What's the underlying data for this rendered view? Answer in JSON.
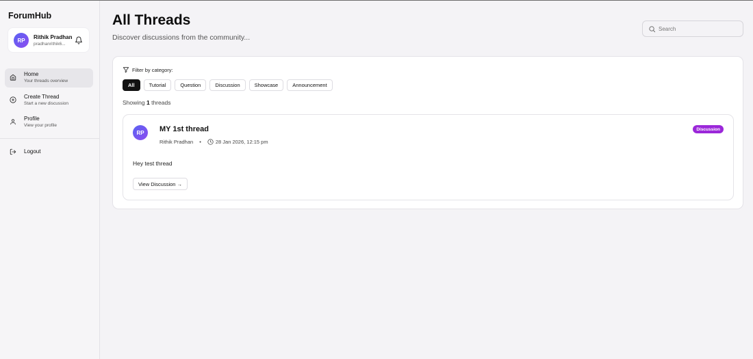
{
  "app": {
    "brand": "ForumHub"
  },
  "user": {
    "initials": "RP",
    "name": "Rithik Pradhan",
    "email": "pradhanrithik6..."
  },
  "nav": {
    "items": [
      {
        "title": "Home",
        "subtitle": "Your threads overview",
        "icon": "home-icon",
        "active": true
      },
      {
        "title": "Create Thread",
        "subtitle": "Start a new discussion",
        "icon": "plus-circle-icon",
        "active": false
      },
      {
        "title": "Profile",
        "subtitle": "View your profile",
        "icon": "user-icon",
        "active": false
      }
    ],
    "logout": "Logout"
  },
  "header": {
    "title": "All Threads",
    "subtitle": "Discover discussions from the community..."
  },
  "search": {
    "placeholder": "Search"
  },
  "filter": {
    "label": "Filter by category:",
    "categories": [
      "All",
      "Tutorial",
      "Question",
      "Discussion",
      "Showcase",
      "Announcement"
    ],
    "selected": "All"
  },
  "results": {
    "prefix": "Showing",
    "count": "1",
    "suffix": "threads"
  },
  "threads": [
    {
      "initials": "RP",
      "title": "MY 1st thread",
      "author": "Rithik Pradhan",
      "separator": "•",
      "date": "28 Jan 2026, 12:15 pm",
      "category": "Discussion",
      "body": "Hey test thread",
      "cta": "View Discussion →"
    }
  ],
  "colors": {
    "accent_start": "#5a63f2",
    "accent_end": "#8d4cf0",
    "badge": "#9b27d9",
    "active_chip": "#111111"
  }
}
